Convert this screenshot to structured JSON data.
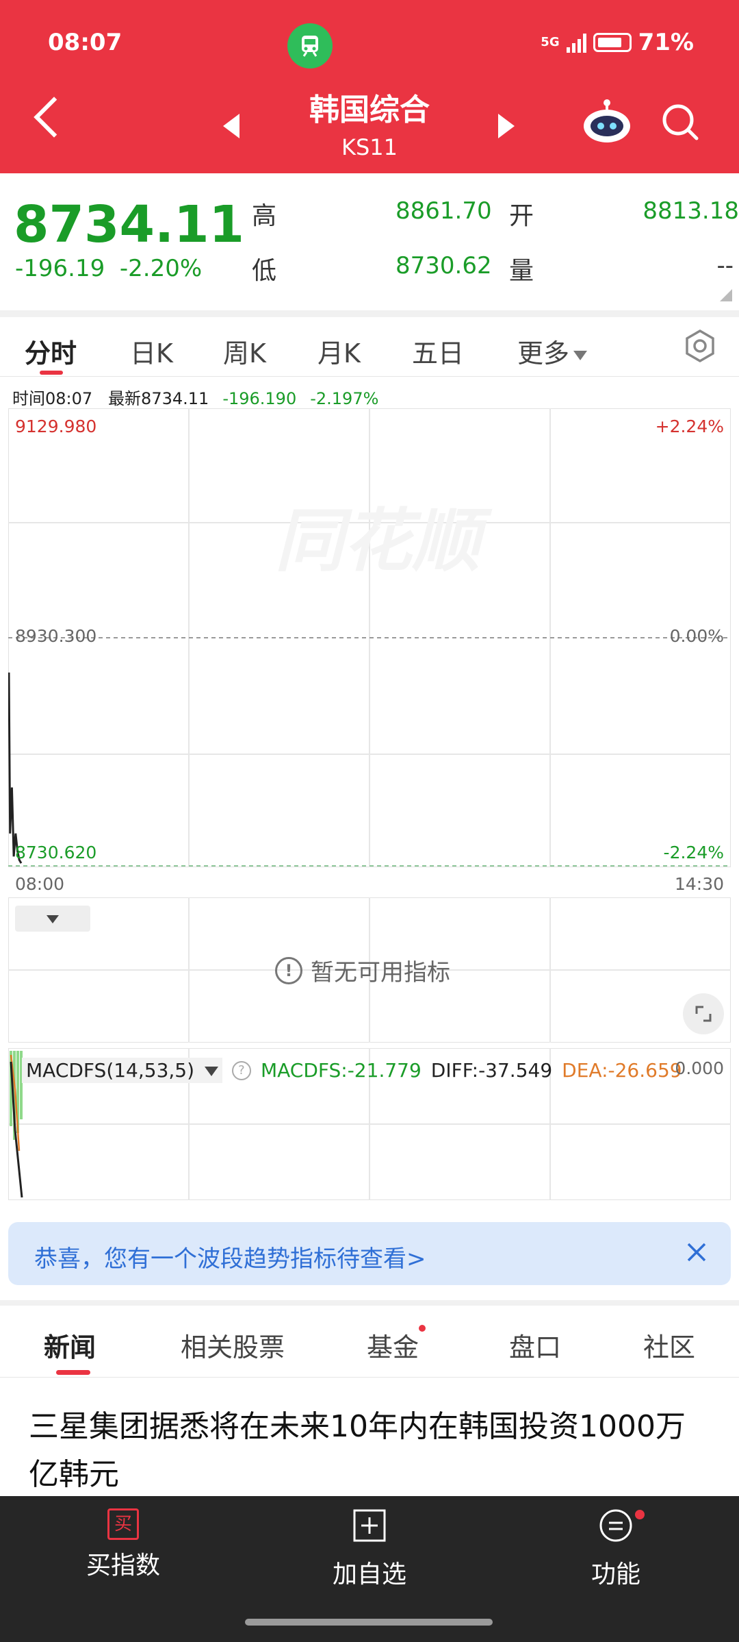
{
  "status_bar": {
    "time": "08:07",
    "network": "5G",
    "battery": "71%"
  },
  "header": {
    "title": "韩国综合",
    "code": "KS11"
  },
  "quote": {
    "price": "8734.11",
    "change": "-196.19",
    "change_pct": "-2.20%",
    "high_label": "高",
    "high": "8861.70",
    "low_label": "低",
    "low": "8730.62",
    "open_label": "开",
    "open": "8813.18",
    "volume_label": "量",
    "volume": "--"
  },
  "tabs": [
    "分时",
    "日K",
    "周K",
    "月K",
    "五日",
    "更多"
  ],
  "info_line": {
    "time": "时间08:07",
    "latest": "最新8734.11",
    "change": "-196.190",
    "pct": "-2.197%"
  },
  "chart_data": {
    "type": "line",
    "title": "",
    "xlabel": "",
    "ylabel": "",
    "x_ticks": [
      "08:00",
      "14:30"
    ],
    "y_left_ticks": [
      "9129.980",
      "8930.300",
      "8730.620"
    ],
    "y_right_ticks": [
      "+2.24%",
      "0.00%",
      "-2.24%"
    ],
    "ylim": [
      8730.62,
      9129.98
    ],
    "reference": 8930.3,
    "series": [
      {
        "x": [
          "08:00",
          "08:01",
          "08:02",
          "08:03",
          "08:04",
          "08:05",
          "08:06",
          "08:07"
        ],
        "values": [
          8900,
          8760,
          8800,
          8740,
          8760,
          8745,
          8737,
          8734.11
        ]
      }
    ],
    "grid": true
  },
  "watermark": "同花顺",
  "indicator_panel": {
    "empty_text": "暂无可用指标"
  },
  "macd": {
    "name": "MACDFS(14,53,5)",
    "macdfs": "MACDFS:-21.779",
    "diff": "DIFF:-37.549",
    "dea": "DEA:-26.659",
    "zero": "0.000"
  },
  "banner": {
    "text": "恭喜，您有一个波段趋势指标待查看>"
  },
  "news_tabs": [
    "新闻",
    "相关股票",
    "基金",
    "盘口",
    "社区"
  ],
  "news_headline": "三星集团据悉将在未来10年内在韩国投资1000万亿韩元",
  "bottom_bar": {
    "buy_icon": "买",
    "buy": "买指数",
    "add": "加自选",
    "func": "功能"
  },
  "colors": {
    "header": "#ea3442",
    "down": "#1a9c28",
    "up": "#d5322f",
    "banner_text": "#2f6fd6"
  }
}
